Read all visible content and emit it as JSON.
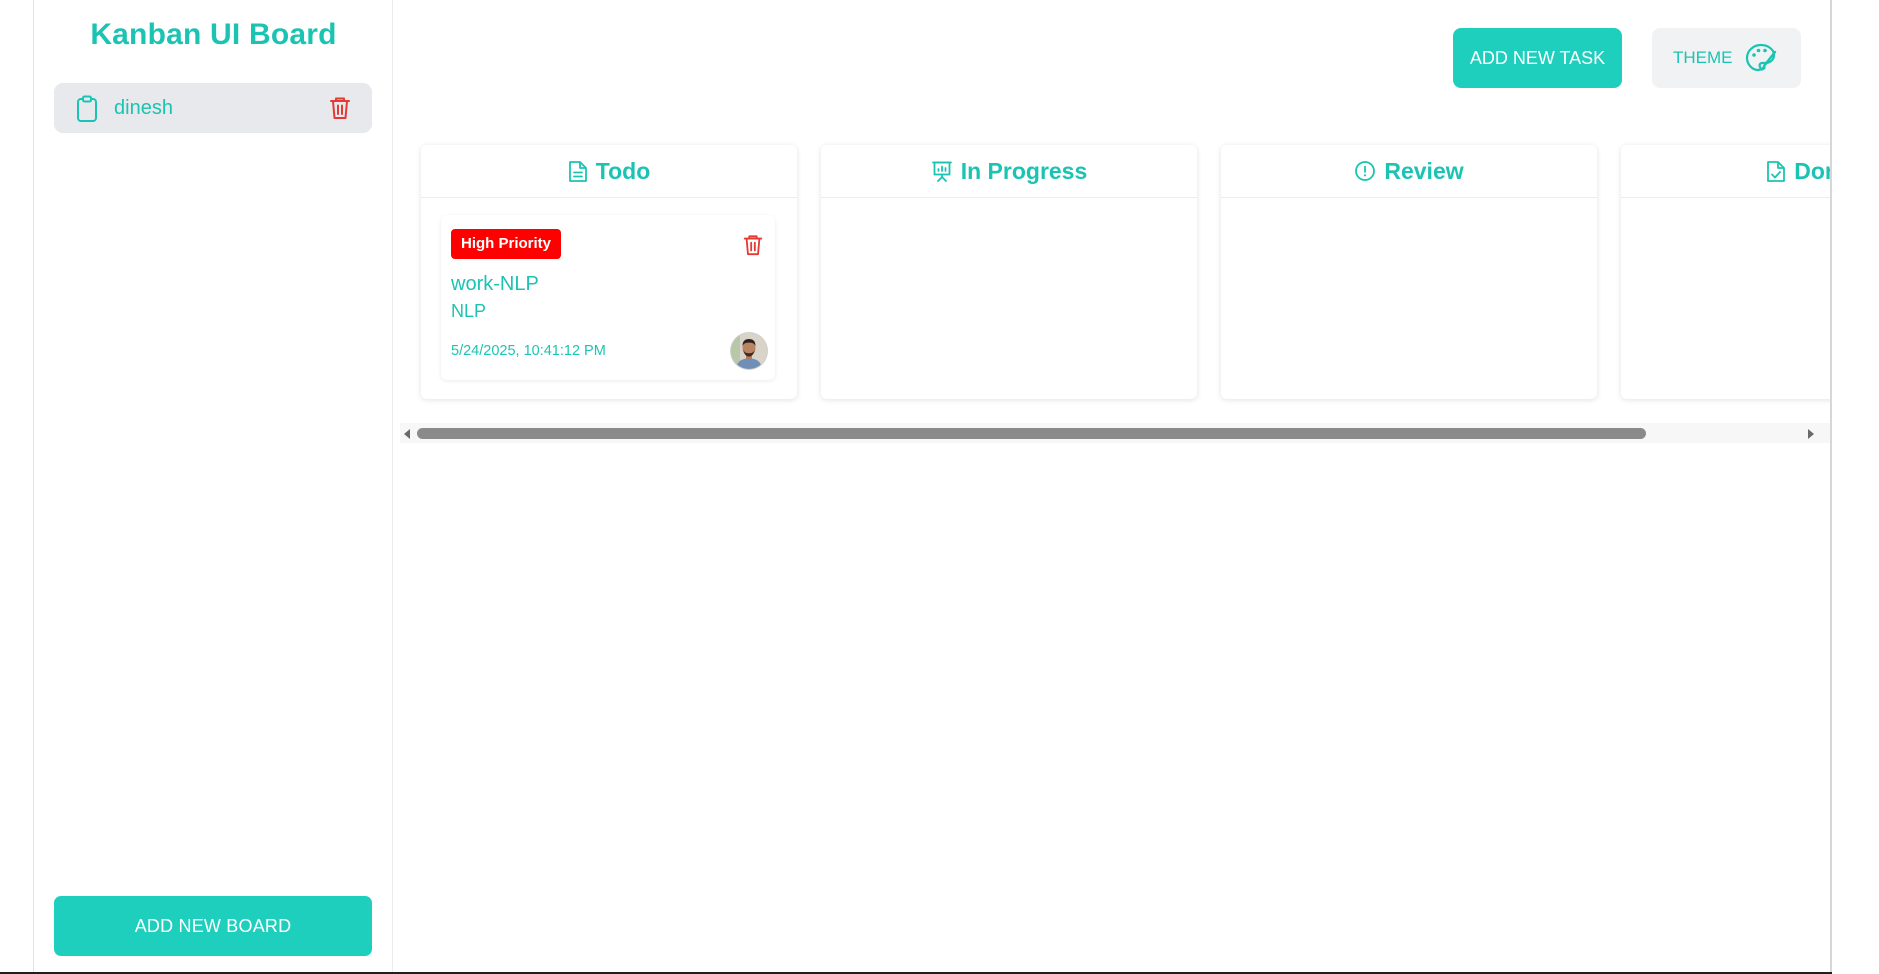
{
  "sidebar": {
    "title": "Kanban UI Board",
    "boards": [
      {
        "name": "dinesh",
        "icon": "clipboard-icon"
      }
    ],
    "add_board_label": "ADD NEW BOARD"
  },
  "header": {
    "add_task_label": "ADD NEW TASK",
    "theme_label": "THEME",
    "theme_icon": "palette-icon"
  },
  "columns": [
    {
      "title": "Todo",
      "icon": "file-text-icon"
    },
    {
      "title": "In Progress",
      "icon": "presentation-chart-icon"
    },
    {
      "title": "Review",
      "icon": "alert-circle-icon"
    },
    {
      "title": "Done",
      "icon": "file-check-icon"
    }
  ],
  "tasks": [
    {
      "column": "Todo",
      "priority": "High Priority",
      "title": "work-NLP",
      "description": "NLP",
      "date": "5/24/2025, 10:41:12 PM"
    }
  ],
  "colors": {
    "accent": "#1fcfbd",
    "accent_text": "#1bc4b2",
    "danger": "#ff0000",
    "delete_icon": "#e53935",
    "board_item_bg": "#e7e9ec"
  }
}
